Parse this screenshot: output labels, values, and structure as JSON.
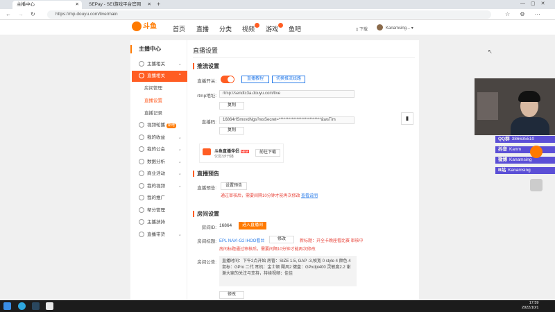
{
  "browser": {
    "tabs": [
      {
        "label": "主播中心",
        "active": true
      },
      {
        "label": "SEPay - SEI游戏平台官网",
        "active": false
      }
    ],
    "url": "https://mp.douyu.com/live/main"
  },
  "header": {
    "logo_text": "斗鱼",
    "nav": [
      "首页",
      "直播",
      "分类",
      "视频",
      "游戏",
      "鱼吧"
    ],
    "download_label": "下载",
    "username": "Kanamsing..."
  },
  "sidebar": {
    "title": "主播中心",
    "items": [
      {
        "label": "主播相关",
        "icon": "mic-icon",
        "active": false
      },
      {
        "label": "直播相关",
        "icon": "live-icon",
        "active": true
      },
      {
        "label": "视频轮播",
        "icon": "video-icon",
        "badge": "新增"
      },
      {
        "label": "我的收益",
        "icon": "money-icon"
      },
      {
        "label": "我的公会",
        "icon": "guild-icon"
      },
      {
        "label": "数据分析",
        "icon": "chart-icon"
      },
      {
        "label": "商业活动",
        "icon": "shop-icon"
      },
      {
        "label": "我的视频",
        "icon": "film-icon"
      },
      {
        "label": "我的推广",
        "icon": "promo-icon"
      },
      {
        "label": "帮分管理",
        "icon": "manage-icon"
      },
      {
        "label": "主播扶持",
        "icon": "support-icon"
      },
      {
        "label": "直播带货",
        "icon": "cart-icon"
      }
    ],
    "subitems": [
      {
        "label": "房间管理",
        "active": false
      },
      {
        "label": "直播设置",
        "active": true
      },
      {
        "label": "直播记录",
        "active": false
      }
    ]
  },
  "main": {
    "title": "直播设置",
    "push": {
      "section": "推流设置",
      "switch_label": "直播开关:",
      "link1": "直播教程",
      "link2": "切换推流线路",
      "rtmp_label": "rtmp地址:",
      "rtmp_value": "rtmp://sendtc3a.douyu.com/live",
      "copy1": "复制",
      "code_label": "直播码:",
      "code_value": "16864rfSmxvdNgs?wsSecret=**************************&wsTim",
      "copy2": "复制",
      "promo_title": "斗鱼直播伴侣",
      "promo_badge": "NEW",
      "promo_sub": "仅需3步开播",
      "promo_btn": "前往下载"
    },
    "preview": {
      "section": "直播预告",
      "label": "直播预告:",
      "btn": "设置预告",
      "warn": "通过审核后，需要间隔10分钟才能再次修改",
      "link": "查看说明"
    },
    "room": {
      "section": "房间设置",
      "id_label": "房间ID:",
      "id_value": "16864",
      "enter_btn": "进入直播间",
      "title_label": "房间标题:",
      "title_value": "EPL NAVI-G2 IHOO看台",
      "modify_btn": "修改",
      "title_right": "新标题：开全卡晚座看比赛  审核中",
      "title_warn": "房间标题通过审核后，需要间隔10分钟才能再次修改",
      "notice_label": "房间公告:",
      "notice_text": "直播时间：下午2点开始 房管：SIZE 1.5, GAP -3,帧宽 0 style 4 颜色 4 鼠标：GPro 二代 耳机：金士顿 飓风2 键盘：GPxdpi400 灵敏度2.2 谢谢大家的关注与支持，持续视频：佳佳",
      "notice_btn": "修改"
    }
  },
  "overlay": {
    "socials": [
      {
        "platform": "QQ群",
        "text": "386635510"
      },
      {
        "platform": "抖音",
        "text": "Kanm"
      },
      {
        "platform": "微博",
        "text": "Kanamsing"
      },
      {
        "platform": "B站",
        "text": "Kanamsing"
      }
    ]
  },
  "taskbar": {
    "time": "17:59",
    "date": "2022/10/1"
  }
}
